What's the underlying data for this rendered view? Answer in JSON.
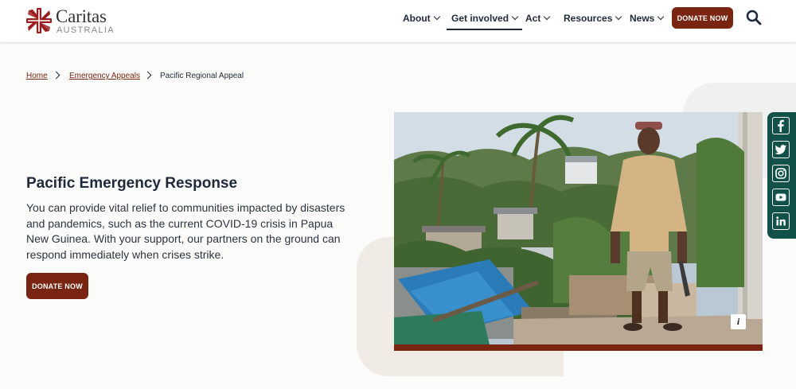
{
  "header": {
    "logo": {
      "name": "Caritas",
      "sub": "AUSTRALIA",
      "brand_color": "#9b1c1f"
    },
    "nav": [
      {
        "label": "About",
        "active": false
      },
      {
        "label": "Get involved",
        "active": true
      },
      {
        "label": "Act",
        "active": false
      },
      {
        "label": "Resources",
        "active": false
      },
      {
        "label": "News",
        "active": false
      }
    ],
    "donate_label": "DONATE NOW",
    "search_icon": "search-icon"
  },
  "breadcrumb": {
    "items": [
      "Home",
      "Emergency Appeals"
    ],
    "current": "Pacific Regional Appeal"
  },
  "hero": {
    "title": "Pacific Emergency Response",
    "text": "You can provide vital relief to communities impacted by disasters and pandemics, such as the current COVID-19 crisis in Papua New Guinea. With your support, our partners on the ground can respond immediately when crises strike.",
    "donate_label": "DONATE NOW",
    "image_info_label": "i"
  },
  "social": [
    "facebook-icon",
    "twitter-icon",
    "instagram-icon",
    "youtube-icon",
    "linkedin-icon"
  ],
  "colors": {
    "accent": "#7a2512",
    "text": "#1e2a3a",
    "social_bg": "#12504a"
  }
}
